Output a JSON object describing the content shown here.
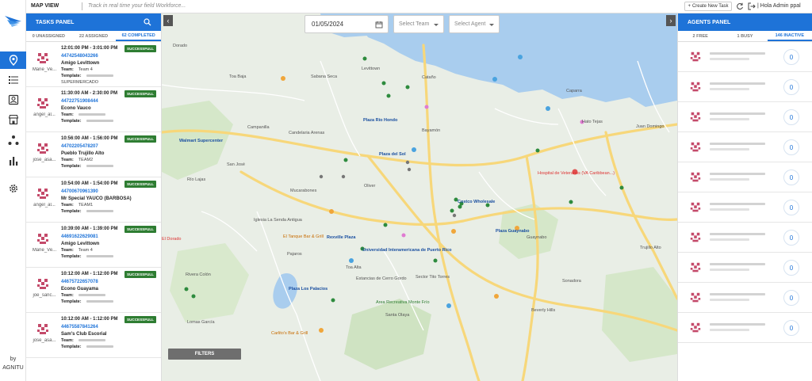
{
  "app": {
    "title": "MAP VIEW",
    "tagline": "Track in real time your field Workforce...",
    "create_task_label": "Create New Task",
    "greeting": "Hola Admin ppal",
    "by_label": "by",
    "brand": "AGNITU"
  },
  "tasks_panel": {
    "title": "TASKS PANEL",
    "tabs": [
      {
        "label": "0 UNASSIGNED"
      },
      {
        "label": "22 ASSIGNED"
      },
      {
        "label": "62 COMPLETED"
      }
    ],
    "labels": {
      "team": "Team:",
      "template": "Template:"
    },
    "items": [
      {
        "time": "12:01:00 PM - 3:01:00 PM",
        "status": "SUCCESSFULL",
        "ref": "44742548043266",
        "site": "Amigo Levittown",
        "team": "Team 4",
        "template": "SUPERMERCADO",
        "agent": "Marie_Ve..."
      },
      {
        "time": "11:30:00 AM - 2:30:00 PM",
        "status": "SUCCESSFULL",
        "ref": "44722751908444",
        "site": "Econo Vauco",
        "team": "",
        "template": "",
        "agent": "angel_al..."
      },
      {
        "time": "10:56:00 AM - 1:56:00 PM",
        "status": "SUCCESSFULL",
        "ref": "44702205478207",
        "site": "Pueblo Trujillo Alto",
        "team": "TEAM2",
        "template": "",
        "agent": "jose_asa..."
      },
      {
        "time": "10:54:00 AM - 1:54:00 PM",
        "status": "SUCCESSFULL",
        "ref": "44700670961390",
        "site": "Mr Special YAUCO (BARBOSA)",
        "team": "TEAM1",
        "template": "",
        "agent": "angel_al..."
      },
      {
        "time": "10:39:00 AM - 1:39:00 PM",
        "status": "SUCCESSFULL",
        "ref": "44691622629081",
        "site": "Amigo Levittown",
        "team": "Team 4",
        "template": "",
        "agent": "Marie_Ve..."
      },
      {
        "time": "10:12:00 AM - 1:12:00 PM",
        "status": "SUCCESSFULL",
        "ref": "44675722657078",
        "site": "Econo Guayama",
        "team": "",
        "template": "",
        "agent": "joe_sanc..."
      },
      {
        "time": "10:12:00 AM - 1:12:00 PM",
        "status": "SUCCESSFULL",
        "ref": "44675587841264",
        "site": "Sam's Club Escorial",
        "team": "",
        "template": "",
        "agent": "jose_asa..."
      }
    ]
  },
  "map_controls": {
    "date": "01/05/2024",
    "team_placeholder": "Select Team",
    "agent_placeholder": "Select Agent",
    "filters_label": "FILTERS"
  },
  "map_labels": [
    "Toa Baja",
    "Levittown",
    "Sabana Seca",
    "Cataño",
    "Guaynabo",
    "Bayamón",
    "Caparra",
    "Campanilla",
    "Candelaria Arenas",
    "San José",
    "Mucarabones",
    "Oliver",
    "Pajaros",
    "Santa Olaya",
    "Sector Tito Torres",
    "Estancias de Cerro Gordo",
    "Sonadora",
    "Beverly Hills",
    "Trujillo Alto",
    "Dorado",
    "Hato Tejas",
    "Juan Domingo",
    "Hospital de Veteranos (VA Caribbean...)",
    "Plaza Guaynabo",
    "Costco Wholesale",
    "Plaza Río Hondo",
    "Plaza del Sol",
    "Walmart Supercenter",
    "Sabana Seca",
    "Río Lajas",
    "Plaza Los Palacios",
    "Area Recreativa Monte Frío",
    "Iglesia La Senda Antigua",
    "El Tanque Bar & Grill",
    "Rexville Plaza",
    "Universidad Interamericana de Puerto Rico",
    "Toa Alta",
    "Rivera Colón",
    "Lomas García",
    "El Dorado",
    "Carlito's Bar & Grill",
    "Walmart Supercenter",
    "Campanilla",
    "Guaynabo"
  ],
  "agents_panel": {
    "title": "AGENTS PANEL",
    "tabs": [
      {
        "label": "2 FREE"
      },
      {
        "label": "1 BUSY"
      },
      {
        "label": "146 INACTIVE"
      }
    ],
    "counts": [
      0,
      0,
      0,
      0,
      0,
      0,
      0,
      0,
      0,
      0
    ]
  },
  "colors": {
    "primary": "#1e73d8",
    "success": "#2e7d32",
    "water": "#a9cdee",
    "road": "#f7d77a"
  }
}
